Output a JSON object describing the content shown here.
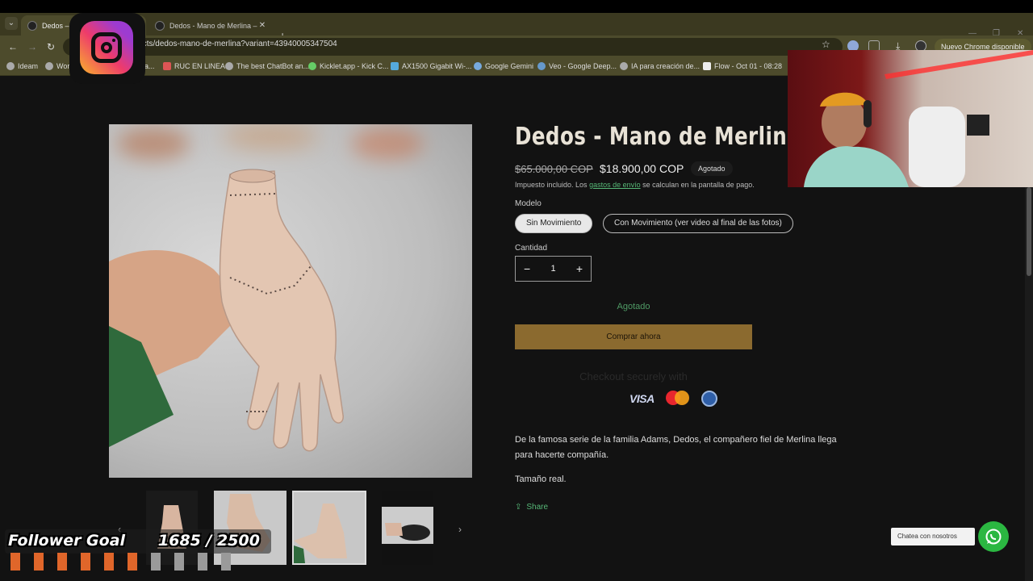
{
  "browser": {
    "tabs": [
      {
        "label": "Dedos – Mano",
        "active": true
      },
      {
        "label": "Dedos - Mano de Merlina – To",
        "active": false
      }
    ],
    "url": "os-col.com/products/dedos-mano-de-merlina?variant=43940005347504",
    "update_label": "Nuevo Chrome disponible",
    "bookmarks": [
      "Ideam",
      "Work",
      "tama...",
      "RUC EN LINEA",
      "The best ChatBot an...",
      "Kicklet.app - Kick C...",
      "AX1500 Gigabit Wi-...",
      "Google Gemini",
      "Veo - Google Deep...",
      "IA para creación de...",
      "Flow - Oct 01 - 08:28"
    ]
  },
  "product": {
    "title": "Dedos - Mano de Merlina",
    "price_old": "$65.000,00 COP",
    "price_new": "$18.900,00 COP",
    "badge": "Agotado",
    "tax_prefix": "Impuesto incluido. Los ",
    "tax_link": "gastos de envío",
    "tax_suffix": " se calculan en la pantalla de pago.",
    "model_label": "Modelo",
    "variants": [
      "Sin Movimiento",
      "Con Movimiento (ver video al final de las fotos)"
    ],
    "selected_variant": 0,
    "quantity_label": "Cantidad",
    "quantity": "1",
    "sold_out": "Agotado",
    "buy_now": "Comprar ahora",
    "checkout_text": "Checkout securely with",
    "payment_methods": [
      "VISA",
      "mastercard",
      "pse"
    ],
    "description": "De la famosa serie de la familia Adams, Dedos, el compañero fiel de Merlina llega para hacerte compañía.",
    "size_text": "Tamaño real.",
    "share_label": "Share"
  },
  "chat": {
    "tooltip": "Chatea con nosotros"
  },
  "overlay": {
    "goal_title": "Follower Goal",
    "goal_count": "1685 / 2500",
    "goal_progress": 0.674
  },
  "colors": {
    "accent_button": "#8b6a2f",
    "link_green": "#56b877",
    "whatsapp": "#2bb741"
  }
}
